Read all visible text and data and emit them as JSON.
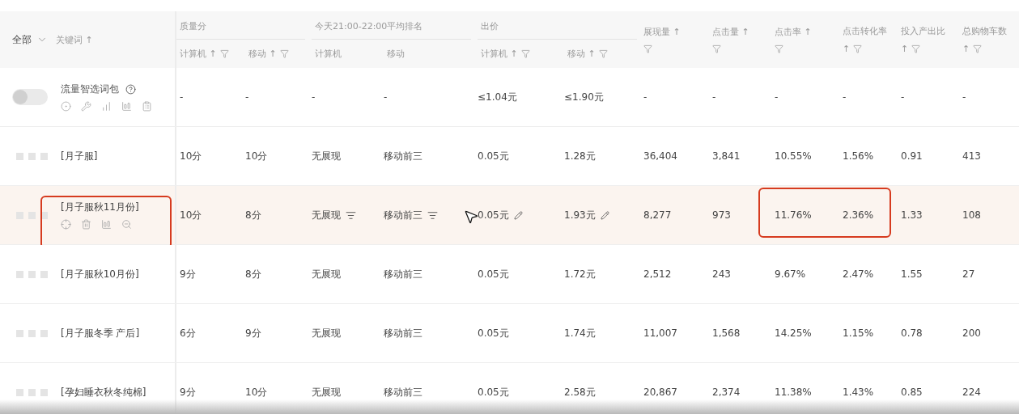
{
  "header": {
    "scope": "全部",
    "keyword": {
      "label": "关键词",
      "sort": "↑"
    },
    "groups": [
      {
        "title": "质量分",
        "columns": [
          {
            "label": "计算机",
            "sort": "↑",
            "filter": true
          },
          {
            "label": "移动",
            "sort": "↑",
            "filter": true
          }
        ]
      },
      {
        "title": "今天21:00-22:00平均排名",
        "columns": [
          {
            "label": "计算机"
          },
          {
            "label": "移动"
          }
        ]
      },
      {
        "title": "出价",
        "columns": [
          {
            "label": "计算机",
            "sort": "↑",
            "filter": true
          },
          {
            "label": "移动",
            "sort": "↑",
            "filter": true
          }
        ]
      }
    ],
    "columns": [
      {
        "label": "展现量",
        "sort": "↑",
        "kind": "split_filter"
      },
      {
        "label": "点击量",
        "sort": "↑",
        "kind": "split_filter"
      },
      {
        "label": "点击率",
        "sort": "↑",
        "kind": "split_filter"
      },
      {
        "label": "点击转化率",
        "sort": "↑",
        "kind": "split_sort"
      },
      {
        "label": "投入产出比",
        "sort": "↑",
        "kind": "split_sort"
      },
      {
        "label": "总购物车数",
        "sort": "↑",
        "kind": "split_sort"
      }
    ]
  },
  "rows": [
    {
      "kind": "package",
      "name": "流量智选词包",
      "on": false,
      "cells": [
        "-",
        "-",
        "-",
        "-",
        "≤1.04元",
        "≤1.90元",
        "-",
        "-",
        "-",
        "-",
        "-",
        "-"
      ]
    },
    {
      "kind": "keyword",
      "name": "[月子服]",
      "hovered": false,
      "cells": [
        "10分",
        "10分",
        "无展现",
        "移动前三",
        "0.05元",
        "1.28元",
        "36,404",
        "3,841",
        "10.55%",
        "1.56%",
        "0.91",
        "413"
      ]
    },
    {
      "kind": "keyword",
      "name": "[月子服秋11月份]",
      "hovered": true,
      "keyword_framed": true,
      "metrics_framed": true,
      "cells": [
        "10分",
        "8分",
        "无展现",
        "移动前三",
        "0.05元",
        "1.93元",
        "8,277",
        "973",
        "11.76%",
        "2.36%",
        "1.33",
        "108"
      ]
    },
    {
      "kind": "keyword",
      "name": "[月子服秋10月份]",
      "hovered": false,
      "cells": [
        "9分",
        "8分",
        "无展现",
        "移动前三",
        "0.05元",
        "1.72元",
        "2,512",
        "243",
        "9.67%",
        "2.47%",
        "1.55",
        "27"
      ]
    },
    {
      "kind": "keyword",
      "name": "[月子服冬季 产后]",
      "hovered": false,
      "cells": [
        "6分",
        "9分",
        "无展现",
        "移动前三",
        "0.05元",
        "1.74元",
        "11,007",
        "1,568",
        "14.25%",
        "1.15%",
        "0.78",
        "200"
      ]
    },
    {
      "kind": "keyword",
      "name": "[孕妇睡衣秋冬纯棉]",
      "hovered": false,
      "cells": [
        "9分",
        "10分",
        "无展现",
        "移动前三",
        "0.05元",
        "2.58元",
        "20,867",
        "2,374",
        "11.38%",
        "1.43%",
        "0.85",
        "224"
      ]
    }
  ]
}
